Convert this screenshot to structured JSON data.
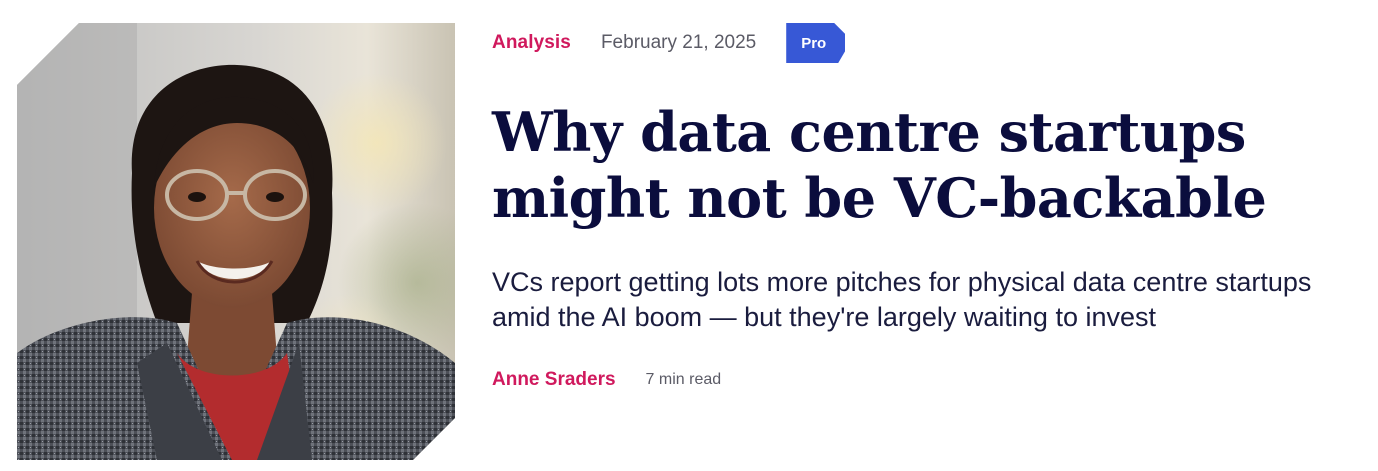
{
  "article": {
    "category": "Analysis",
    "date": "February 21, 2025",
    "badge": "Pro",
    "headline": "Why data centre startups might not be VC-backable",
    "dek": "VCs report getting lots more pitches for physical data centre startups amid the AI boom — but they're largely waiting to invest",
    "author": "Anne Sraders",
    "read_time": "7 min read"
  },
  "colors": {
    "accent": "#d0195d",
    "badge_bg": "#3758d6",
    "headline": "#0b0d3d",
    "muted": "#5b5b66"
  }
}
